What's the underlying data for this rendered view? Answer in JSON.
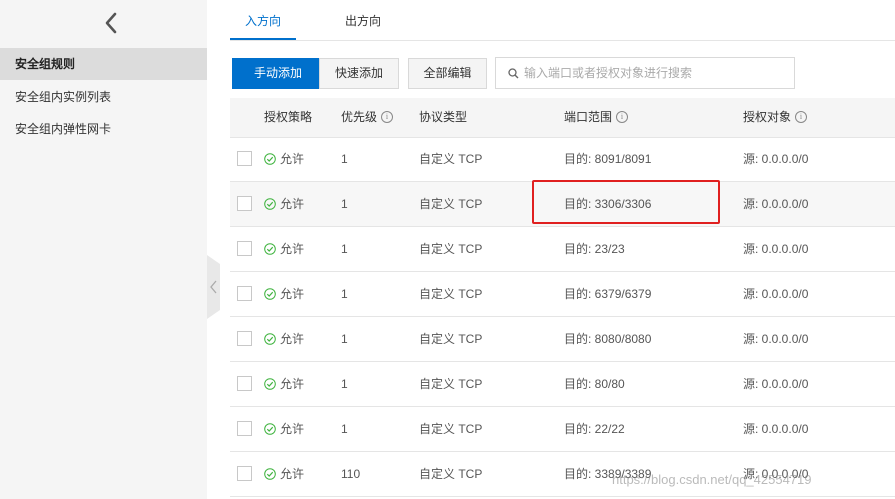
{
  "sidebar": {
    "back_icon": "chevron-left-icon",
    "items": [
      {
        "label": "安全组规则",
        "active": true
      },
      {
        "label": "安全组内实例列表",
        "active": false
      },
      {
        "label": "安全组内弹性网卡",
        "active": false
      }
    ]
  },
  "tabs": [
    {
      "label": "入方向",
      "active": true
    },
    {
      "label": "出方向",
      "active": false
    }
  ],
  "toolbar": {
    "manual_add_label": "手动添加",
    "quick_add_label": "快速添加",
    "edit_all_label": "全部编辑",
    "search_placeholder": "输入端口或者授权对象进行搜索"
  },
  "table": {
    "headers": {
      "policy": "授权策略",
      "priority": "优先级",
      "protocol": "协议类型",
      "port_range": "端口范围",
      "auth_object": "授权对象"
    },
    "rows": [
      {
        "policy": "允许",
        "priority": "1",
        "protocol": "自定义 TCP",
        "port": "目的: 8091/8091",
        "source": "源: 0.0.0.0/0"
      },
      {
        "policy": "允许",
        "priority": "1",
        "protocol": "自定义 TCP",
        "port": "目的: 3306/3306",
        "source": "源: 0.0.0.0/0"
      },
      {
        "policy": "允许",
        "priority": "1",
        "protocol": "自定义 TCP",
        "port": "目的: 23/23",
        "source": "源: 0.0.0.0/0"
      },
      {
        "policy": "允许",
        "priority": "1",
        "protocol": "自定义 TCP",
        "port": "目的: 6379/6379",
        "source": "源: 0.0.0.0/0"
      },
      {
        "policy": "允许",
        "priority": "1",
        "protocol": "自定义 TCP",
        "port": "目的: 8080/8080",
        "source": "源: 0.0.0.0/0"
      },
      {
        "policy": "允许",
        "priority": "1",
        "protocol": "自定义 TCP",
        "port": "目的: 80/80",
        "source": "源: 0.0.0.0/0"
      },
      {
        "policy": "允许",
        "priority": "1",
        "protocol": "自定义 TCP",
        "port": "目的: 22/22",
        "source": "源: 0.0.0.0/0"
      },
      {
        "policy": "允许",
        "priority": "110",
        "protocol": "自定义 TCP",
        "port": "目的: 3389/3389",
        "source": "源: 0.0.0.0/0"
      }
    ]
  },
  "watermark": "https://blog.csdn.net/qq_42554719",
  "colors": {
    "primary": "#0070cc",
    "allow_green": "#3fb33f",
    "highlight_red": "#e02020"
  }
}
